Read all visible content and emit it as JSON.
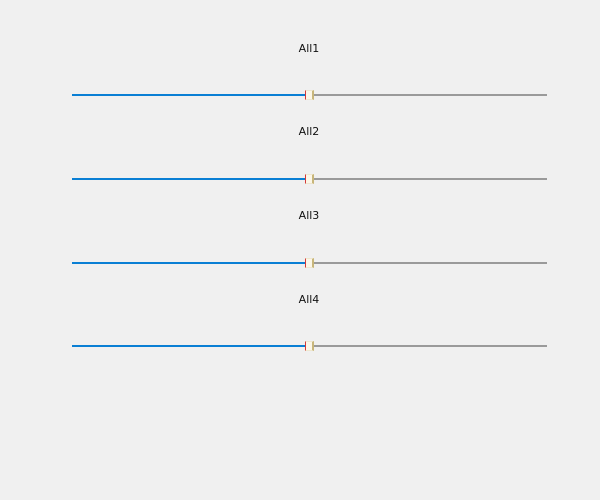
{
  "sliders": [
    {
      "label": "All1",
      "value_fraction": 0.49
    },
    {
      "label": "All2",
      "value_fraction": 0.49
    },
    {
      "label": "All3",
      "value_fraction": 0.49
    },
    {
      "label": "All4",
      "value_fraction": 0.49
    }
  ],
  "colors": {
    "background": "#f0f0f0",
    "track_filled": "#0a7fd4",
    "track_empty": "#9a9a9a",
    "thumb_left_edge": "#d33a3a",
    "thumb_right_edge": "#c8b67a"
  }
}
